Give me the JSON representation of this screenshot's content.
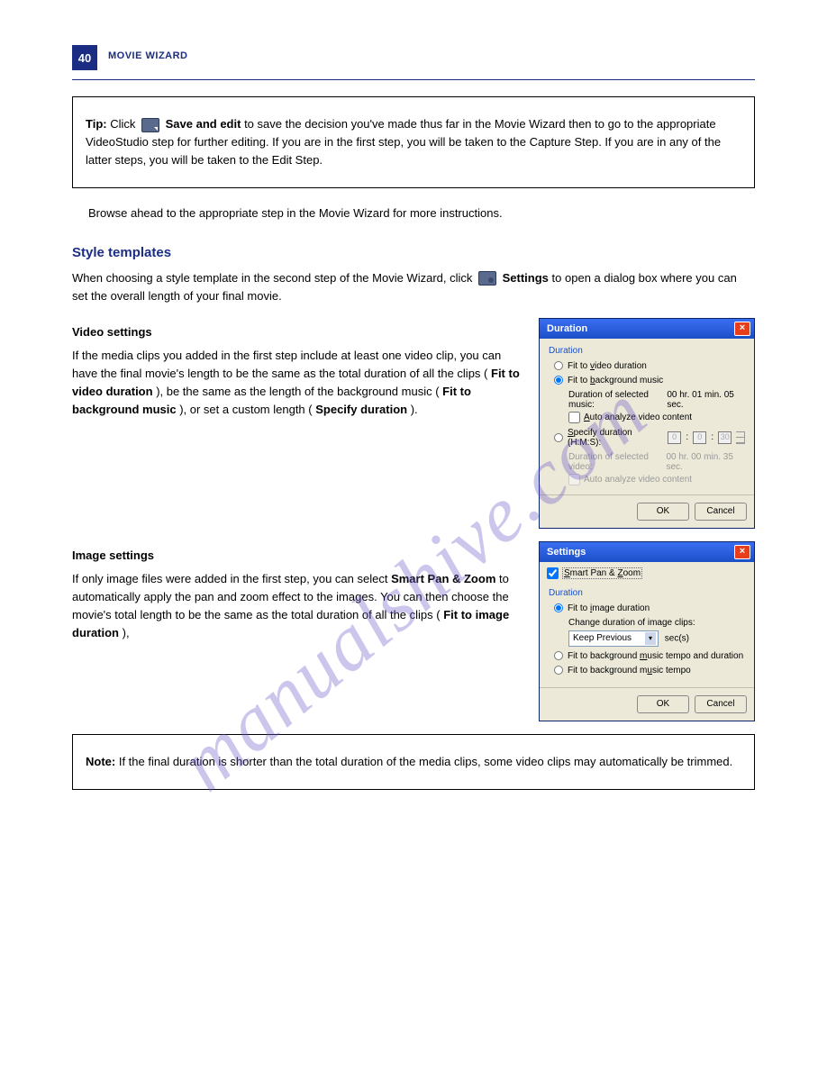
{
  "page": {
    "number": "40",
    "section": "MOVIE WIZARD"
  },
  "watermark": "manualshive.com",
  "tip": {
    "label": "Tip:",
    "line1_a": "Click ",
    "line1_b": "Save and edit",
    "line1_c": " to save the decision you've made thus far in the Movie Wizard then to go to the appropriate VideoStudio step for further editing. If you are in the first step, you will be taken to the Capture Step. If you are in any of the latter steps, you will be taken to the Edit Step."
  },
  "step2browse": "Browse ahead to the appropriate step in the Movie Wizard for more instructions.",
  "heading": "Style templates",
  "para1_a": "When choosing a style template in the second step of the Movie Wizard, click ",
  "para1_b": "Settings",
  "para1_c": " to open a dialog box where you can set the overall length of your final movie.",
  "dur_video": {
    "title": "Video settings",
    "para_a": "If the media clips you added in the first step include at least one video clip, you can have the final movie's length to be the same as the total duration of all the clips (",
    "fit_video": "Fit to video duration",
    "para_b": "), be the same as the length of the background music (",
    "fit_music": "Fit to background music",
    "para_c": "), or set a custom length (",
    "specify": "Specify duration",
    "para_d": ")."
  },
  "dialog1": {
    "title": "Duration",
    "group": "Duration",
    "r1": "Fit to video duration",
    "r2": "Fit to background music",
    "r2_sub_lbl": "Duration of selected music:",
    "r2_sub_val": "00 hr. 01 min. 05 sec.",
    "r2_chk": "Auto analyze video content",
    "r3": "Specify duration (H:M:S):",
    "h": "0",
    "m": "0",
    "s": "30",
    "r3_sub_lbl": "Duration of selected video:",
    "r3_sub_val": "00 hr. 00 min. 35 sec.",
    "r3_chk": "Auto analyze video content",
    "ok": "OK",
    "cancel": "Cancel"
  },
  "dur_image": {
    "title": "Image settings",
    "para_a": "If only image files were added in the first step, you can select ",
    "b1": "Smart Pan & Zoom",
    "para_b": " to automatically apply the pan and zoom effect to the images. You can then choose the movie's total length to be the same as the total duration of all the clips (",
    "b2": "Fit to image duration",
    "para_c": "),"
  },
  "dialog2": {
    "title": "Settings",
    "chk_main": "Smart Pan & Zoom",
    "group": "Duration",
    "r1": "Fit to image duration",
    "r1_sub": "Change duration of image clips:",
    "dd": "Keep Previous",
    "dd_unit": "sec(s)",
    "r2": "Fit to background music tempo and duration",
    "r3": "Fit to background music tempo",
    "ok": "OK",
    "cancel": "Cancel"
  },
  "note": {
    "label": "Note:",
    "text": "If the final duration is shorter than the total duration of the media clips, some video clips may automatically be trimmed."
  }
}
